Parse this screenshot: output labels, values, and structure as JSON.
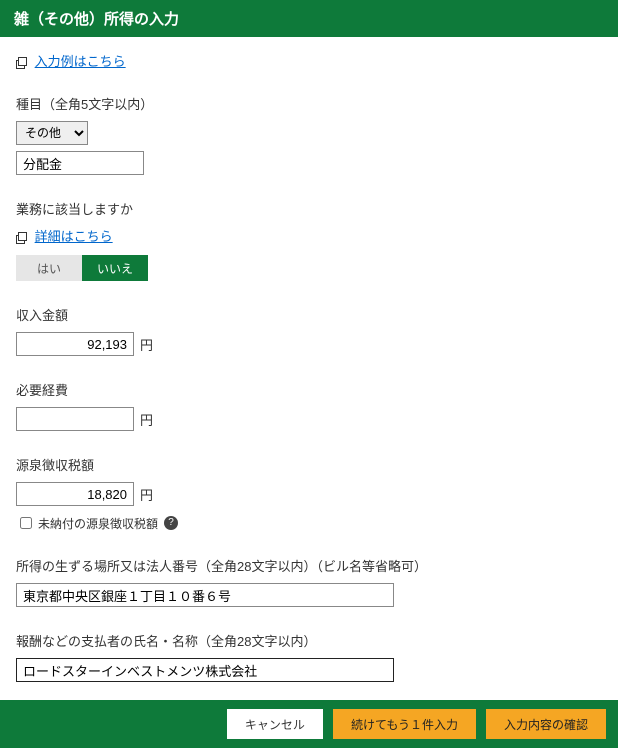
{
  "header": {
    "title": "雑（その他）所得の入力"
  },
  "example_link": "入力例はこちら",
  "category": {
    "label": "種目（全角5文字以内）",
    "select_options": [
      "その他"
    ],
    "select_value": "その他",
    "detail_value": "分配金"
  },
  "business": {
    "label": "業務に該当しますか",
    "detail_link": "詳細はこちら",
    "yes": "はい",
    "no": "いいえ",
    "selected": "no"
  },
  "income": {
    "label": "収入金額",
    "value": "92,193",
    "unit": "円"
  },
  "expense": {
    "label": "必要経費",
    "value": "",
    "unit": "円"
  },
  "withholding": {
    "label": "源泉徴収税額",
    "value": "18,820",
    "unit": "円",
    "unpaid_checkbox_label": "未納付の源泉徴収税額",
    "unpaid_checked": false
  },
  "place": {
    "label": "所得の生ずる場所又は法人番号（全角28文字以内）（ビル名等省略可）",
    "value": "東京都中央区銀座１丁目１０番６号"
  },
  "payer": {
    "label": "報酬などの支払者の氏名・名称（全角28文字以内）",
    "value": "ロードスターインベストメンツ株式会社"
  },
  "footer": {
    "cancel": "キャンセル",
    "continue": "続けてもう１件入力",
    "confirm": "入力内容の確認"
  }
}
